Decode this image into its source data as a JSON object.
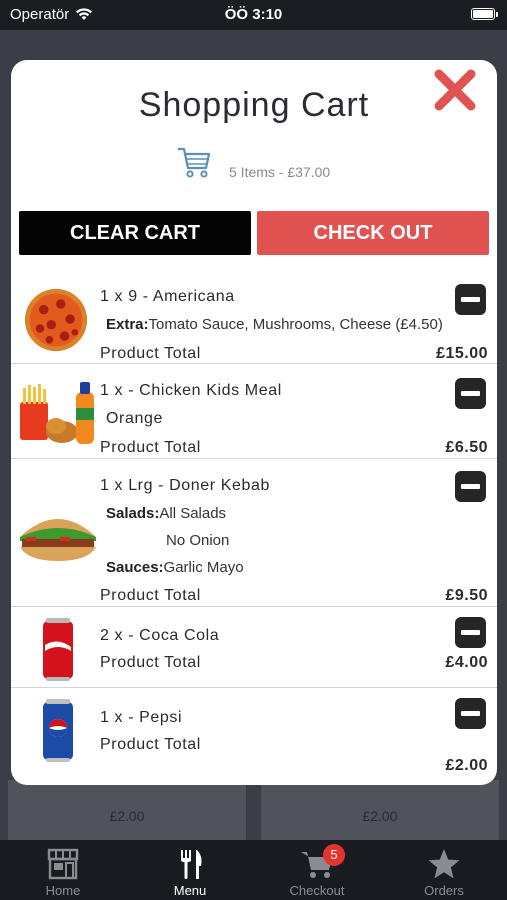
{
  "status_bar": {
    "carrier": "Operatör",
    "time": "ÖÖ 3:10"
  },
  "background": {
    "left_price": "£2.00",
    "right_price": "£2.00"
  },
  "modal": {
    "title": "Shopping Cart",
    "summary": "5 Items - £37.00",
    "clear_label": "CLEAR CART",
    "checkout_label": "CHECK OUT"
  },
  "items": [
    {
      "name": "1 x 9 - Americana",
      "extra_label": "Extra:",
      "extra_value": "Tomato Sauce, Mushrooms, Cheese (£4.50)",
      "total_label": "Product Total",
      "price": "£15.00",
      "image": "pizza"
    },
    {
      "name": "1 x - Chicken Kids Meal",
      "option": "Orange",
      "total_label": "Product Total",
      "price": "£6.50",
      "image": "kids-meal"
    },
    {
      "name": "1 x Lrg - Doner Kebab",
      "salads_label": "Salads:",
      "salads_value": "All Salads",
      "salads_value2": "No Onion",
      "sauces_label": "Sauces:",
      "sauces_value": "Garlic Mayo",
      "total_label": "Product Total",
      "price": "£9.50",
      "image": "doner-kebab"
    },
    {
      "name": "2 x - Coca Cola",
      "total_label": "Product Total",
      "price": "£4.00",
      "image": "coca-cola-can"
    },
    {
      "name": "1 x - Pepsi",
      "total_label": "Product Total",
      "price": "£2.00",
      "image": "pepsi-can"
    }
  ],
  "tabs": [
    {
      "label": "Home",
      "icon": "store-icon"
    },
    {
      "label": "Menu",
      "icon": "fork-knife-icon"
    },
    {
      "label": "Checkout",
      "icon": "cart-icon",
      "badge": "5"
    },
    {
      "label": "Orders",
      "icon": "star-icon"
    }
  ],
  "colors": {
    "checkout": "#e05350",
    "clear": "#050505",
    "close": "#e05350",
    "badge": "#e4342e"
  }
}
